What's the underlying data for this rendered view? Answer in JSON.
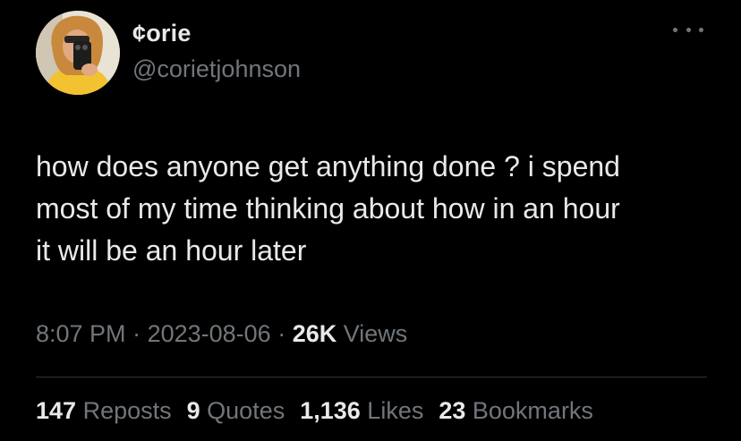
{
  "user": {
    "display_name": "¢orie",
    "handle": "@corietjohnson"
  },
  "tweet": {
    "text": "how does anyone get anything done ? i spend\nmost of my time thinking about how in an hour\nit will be an hour later"
  },
  "meta": {
    "time": "8:07 PM",
    "separator": " · ",
    "date": "2023-08-06",
    "views_count": "26K",
    "views_label": " Views"
  },
  "stats": {
    "reposts_count": "147",
    "reposts_label": " Reposts",
    "quotes_count": "9",
    "quotes_label": " Quotes",
    "likes_count": "1,136",
    "likes_label": " Likes",
    "bookmarks_count": "23",
    "bookmarks_label": " Bookmarks"
  },
  "icons": {
    "more": "more-horizontal-icon"
  },
  "colors": {
    "background": "#000000",
    "primary_text": "#e7e9ea",
    "secondary_text": "#71767b",
    "divider": "#2f3336"
  }
}
